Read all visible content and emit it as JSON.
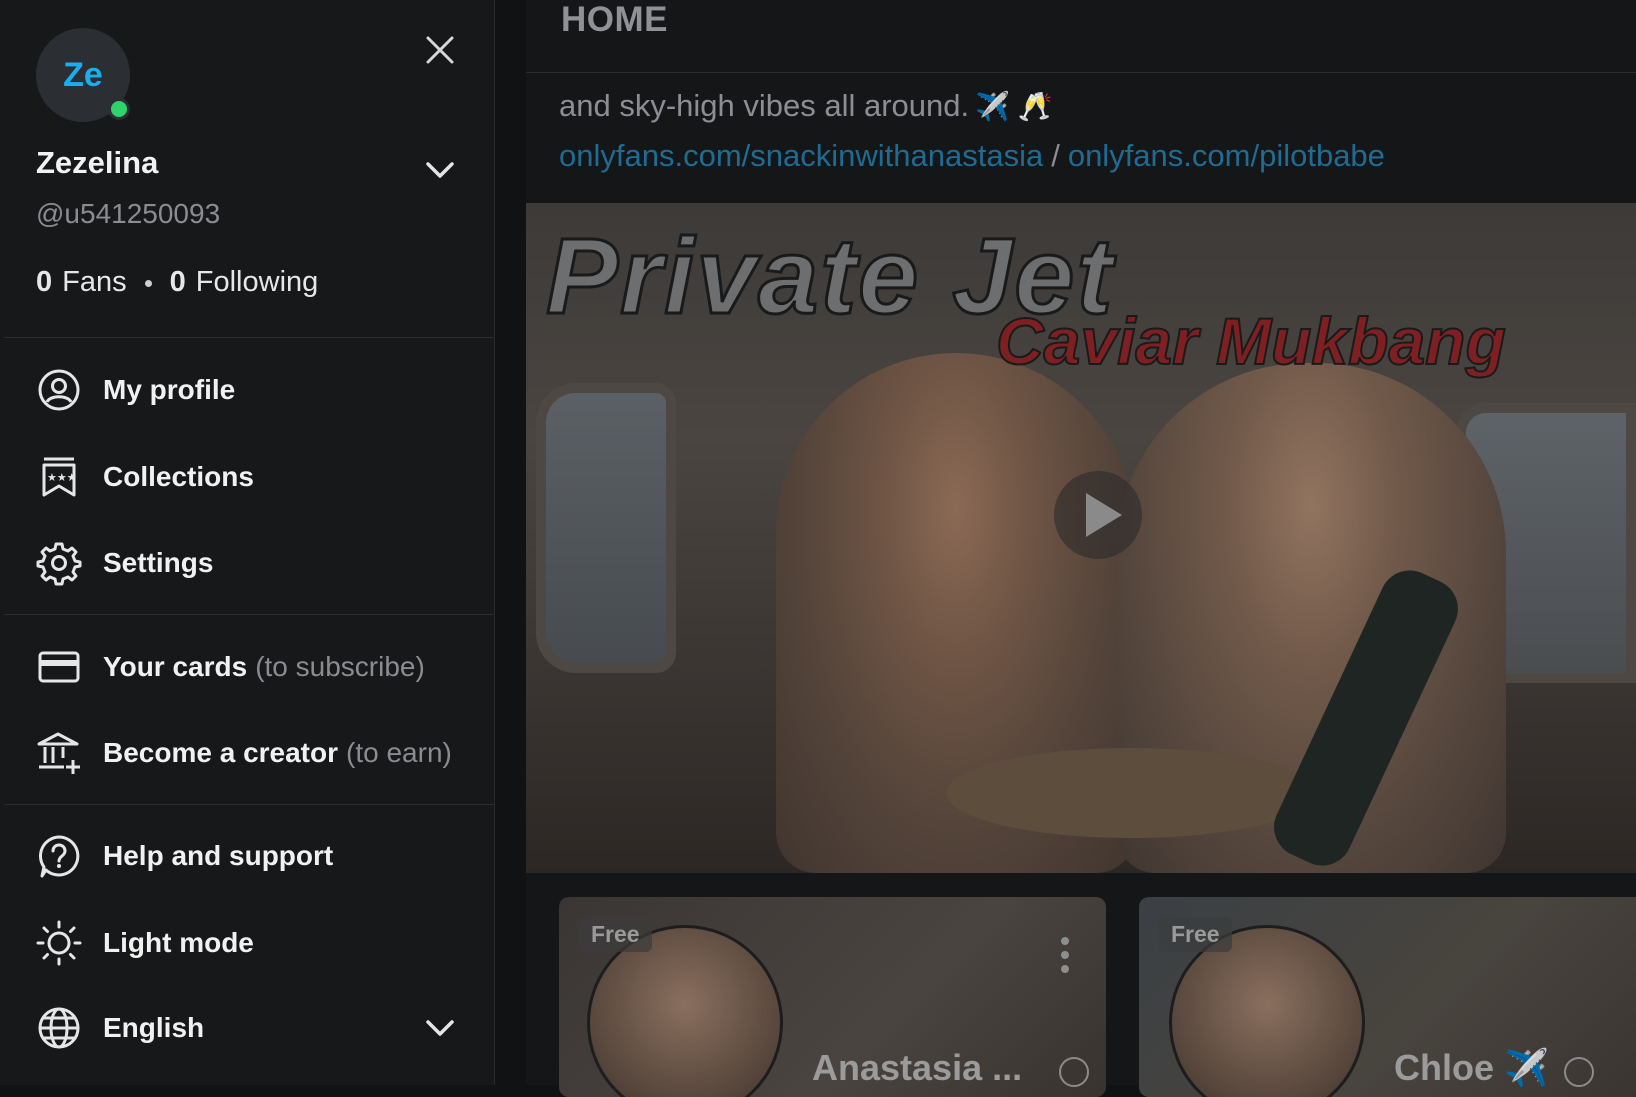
{
  "main": {
    "header_title": "HOME",
    "post_text": "and sky-high vibes all around.",
    "post_emoji": "✈️ 🥂",
    "links": [
      "onlyfans.com/snackinwithanastasia",
      "onlyfans.com/pilotbabe"
    ],
    "link_separator": "/",
    "media": {
      "title_line1": "Private Jet",
      "title_line2": "Caviar Mukbang"
    },
    "cards": [
      {
        "badge": "Free",
        "name": "Anastasia ..."
      },
      {
        "badge": "Free",
        "name": "Chloe ✈️"
      }
    ]
  },
  "sidebar": {
    "avatar_initials": "Ze",
    "display_name": "Zezelina",
    "handle": "@u541250093",
    "fans_count": "0",
    "fans_label": "Fans",
    "following_count": "0",
    "following_label": "Following",
    "menu": {
      "my_profile": "My profile",
      "collections": "Collections",
      "settings": "Settings",
      "your_cards": "Your cards",
      "your_cards_sub": "(to subscribe)",
      "become_creator": "Become a creator",
      "become_creator_sub": "(to earn)",
      "help": "Help and support",
      "light_mode": "Light mode",
      "language": "English"
    }
  },
  "colors": {
    "accent": "#1aaef0",
    "online": "#2fd36a",
    "link": "#1e6b93"
  }
}
